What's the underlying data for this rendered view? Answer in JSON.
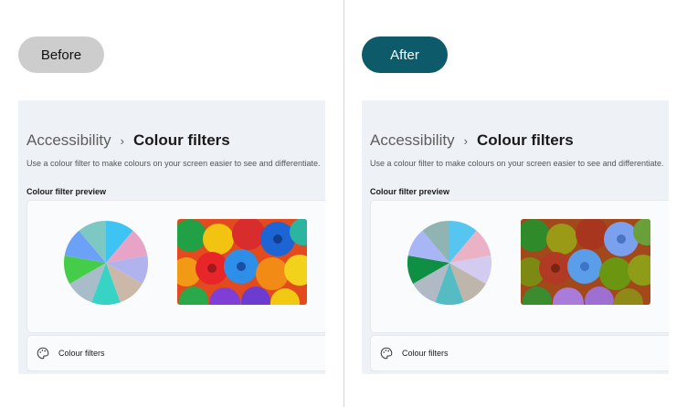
{
  "labels": {
    "before": "Before",
    "after": "After"
  },
  "settings": {
    "breadcrumb_parent": "Accessibility",
    "breadcrumb_separator": "›",
    "breadcrumb_current": "Colour filters",
    "description": "Use a colour filter to make colours on your screen easier to see and differentiate.",
    "preview_label": "Colour filter preview",
    "row_label": "Colour filters",
    "row_icon": "palette-icon"
  },
  "colors": {
    "after_pill": "#0c5a6a",
    "before_pill": "#cdcdcd",
    "settings_bg": "#eef2f7",
    "pie_before": [
      "#3ec4f2",
      "#e7a4c6",
      "#b0b3ee",
      "#cbb8a8",
      "#37d3c4",
      "#a9bcc9",
      "#45cc49",
      "#6ba1f6",
      "#7ec8c4"
    ],
    "pie_after": [
      "#56c6f1",
      "#ebb2c5",
      "#d3ccf0",
      "#bfb6ab",
      "#55bcc4",
      "#b0bac5",
      "#0e8f43",
      "#a8b6f5",
      "#8fb4b2"
    ]
  }
}
